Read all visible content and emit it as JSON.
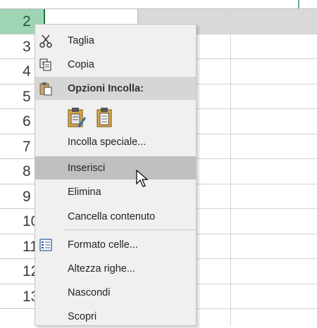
{
  "row_headers": [
    {
      "number": "2",
      "selected": true
    },
    {
      "number": "3"
    },
    {
      "number": "4"
    },
    {
      "number": "5"
    },
    {
      "number": "6"
    },
    {
      "number": "7"
    },
    {
      "number": "8"
    },
    {
      "number": "9"
    },
    {
      "number": "10"
    },
    {
      "number": "11"
    },
    {
      "number": "12"
    },
    {
      "number": "13"
    }
  ],
  "menu": {
    "items": [
      {
        "label": "Taglia",
        "icon": "scissors-icon"
      },
      {
        "label": "Copia",
        "icon": "copy-icon"
      },
      {
        "label": "Opzioni Incolla:",
        "icon": "paste-icon"
      },
      {
        "label": "Incolla speciale..."
      },
      {
        "label": "Inserisci",
        "hovered": true
      },
      {
        "label": "Elimina"
      },
      {
        "label": "Cancella contenuto"
      },
      {
        "label": "Formato celle...",
        "icon": "format-cells-icon"
      },
      {
        "label": "Altezza righe..."
      },
      {
        "label": "Nascondi"
      },
      {
        "label": "Scopri"
      }
    ],
    "paste_options": [
      "paste-formatting-icon",
      "paste-icon"
    ]
  },
  "colors": {
    "selected_header_bg": "#9fd4b5",
    "excel_green": "#217346",
    "menu_bg": "#f0f0f0",
    "hover_bg": "#c0c0c0",
    "section_bg": "#d6d6d6"
  }
}
